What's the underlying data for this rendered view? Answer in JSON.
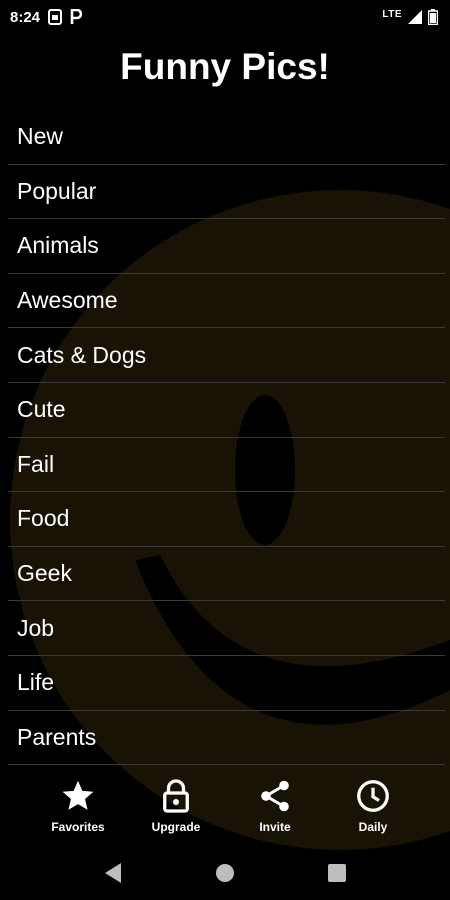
{
  "status_bar": {
    "time": "8:24",
    "lte": "LTE",
    "icons": [
      "sim-card-icon",
      "parking-icon",
      "signal-icon",
      "battery-icon"
    ]
  },
  "title": "Funny Pics!",
  "categories": [
    "New",
    "Popular",
    "Animals",
    "Awesome",
    "Cats & Dogs",
    "Cute",
    "Fail",
    "Food",
    "Geek",
    "Job",
    "Life",
    "Parents"
  ],
  "bottom_nav": [
    {
      "label": "Favorites",
      "icon": "star-icon"
    },
    {
      "label": "Upgrade",
      "icon": "lock-icon"
    },
    {
      "label": "Invite",
      "icon": "share-icon"
    },
    {
      "label": "Daily",
      "icon": "clock-icon"
    }
  ],
  "system_nav": {
    "icons": [
      "back-icon",
      "home-icon",
      "recents-icon"
    ]
  },
  "colors": {
    "background": "#000000",
    "text": "#ffffff",
    "divider": "#3a3a3a",
    "smiley": "#2a2108"
  }
}
